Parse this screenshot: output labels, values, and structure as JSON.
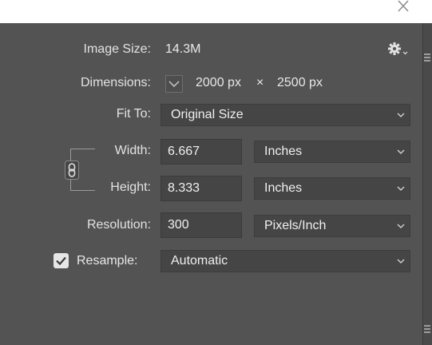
{
  "image_size": {
    "label": "Image Size:",
    "value": "14.3M"
  },
  "dimensions": {
    "label": "Dimensions:",
    "width": "2000 px",
    "separator": "×",
    "height": "2500 px"
  },
  "fit_to": {
    "label": "Fit To:",
    "selected": "Original Size"
  },
  "width": {
    "label": "Width:",
    "value": "6.667",
    "unit": "Inches"
  },
  "height": {
    "label": "Height:",
    "value": "8.333",
    "unit": "Inches"
  },
  "resolution": {
    "label": "Resolution:",
    "value": "300",
    "unit": "Pixels/Inch"
  },
  "resample": {
    "label": "Resample:",
    "checked": true,
    "selected": "Automatic"
  },
  "icons": {
    "close": "close-icon",
    "gear": "gear-icon",
    "chevron": "chevron-down-icon",
    "link": "link-icon",
    "check": "checkmark-icon"
  },
  "colors": {
    "panel": "#535353",
    "field": "#454545",
    "text": "#e3e3e3"
  }
}
